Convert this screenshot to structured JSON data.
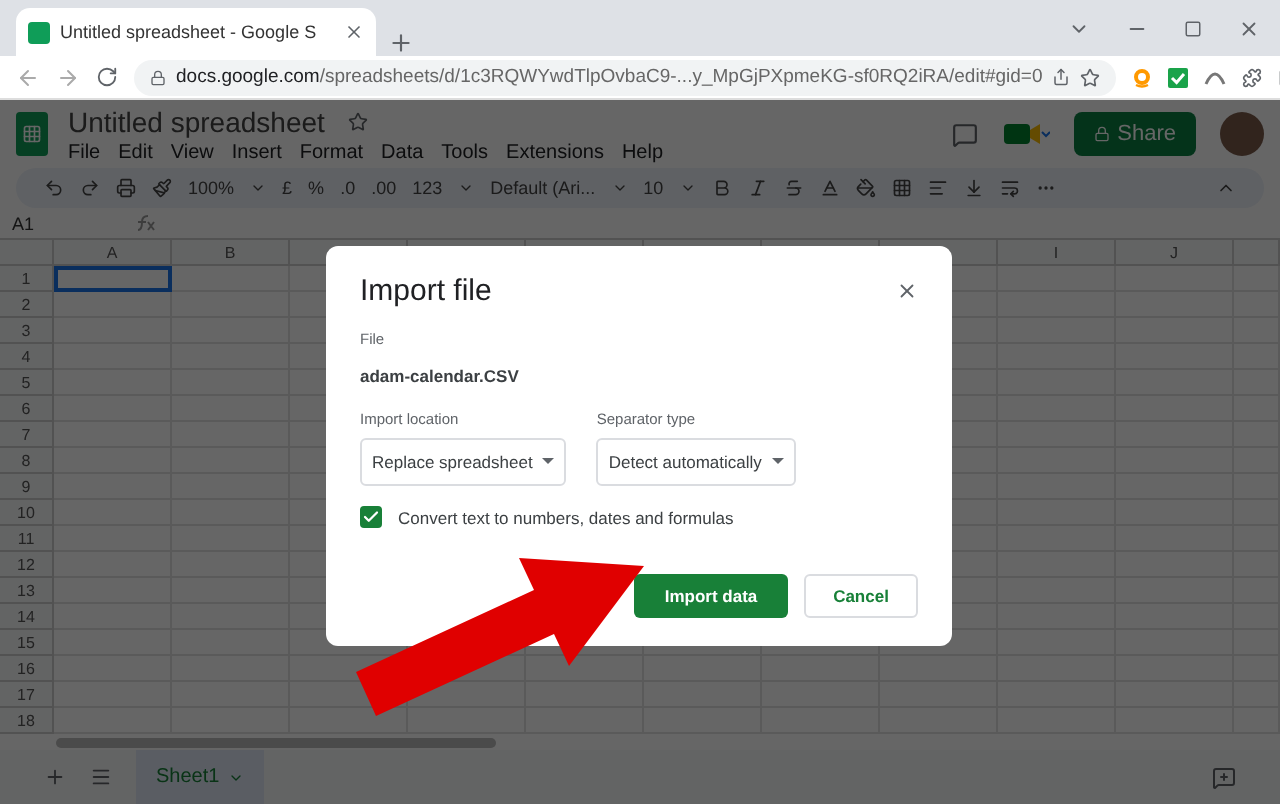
{
  "browser": {
    "tab_title": "Untitled spreadsheet - Google S",
    "url_domain": "docs.google.com",
    "url_path": "/spreadsheets/d/1c3RQWYwdTlpOvbaC9-...y_MpGjPXpmeKG-sf0RQ2iRA/edit#gid=0"
  },
  "app": {
    "doc_title": "Untitled spreadsheet",
    "menus": [
      "File",
      "Edit",
      "View",
      "Insert",
      "Format",
      "Data",
      "Tools",
      "Extensions",
      "Help"
    ],
    "share_label": "Share"
  },
  "toolbar": {
    "zoom": "100%",
    "currency": "£",
    "percent": "%",
    "decimal_less": ".0",
    "decimal_more": ".00",
    "number_format": "123",
    "font": "Default (Ari...",
    "font_size": "10"
  },
  "formula_bar": {
    "cell_ref": "A1"
  },
  "grid": {
    "columns_left": [
      "A",
      "B"
    ],
    "columns_right": [
      "I",
      "J"
    ],
    "rows": [
      "1",
      "2",
      "3",
      "4",
      "5",
      "6",
      "7",
      "8",
      "9",
      "10",
      "11",
      "12",
      "13",
      "14",
      "15",
      "16",
      "17",
      "18"
    ]
  },
  "sheets": [
    {
      "label": "Sheet1",
      "selected": true
    }
  ],
  "dialog": {
    "title": "Import file",
    "file_label": "File",
    "file_name": "adam-calendar.CSV",
    "selects": [
      {
        "label": "Import location",
        "value": "Replace spreadsheet"
      },
      {
        "label": "Separator type",
        "value": "Detect automatically"
      }
    ],
    "convert": {
      "label": "Convert text to numbers, dates and formulas",
      "checked": true
    },
    "buttons": [
      {
        "label": "Import data",
        "kind": "primary"
      },
      {
        "label": "Cancel",
        "kind": "secondary"
      }
    ]
  }
}
